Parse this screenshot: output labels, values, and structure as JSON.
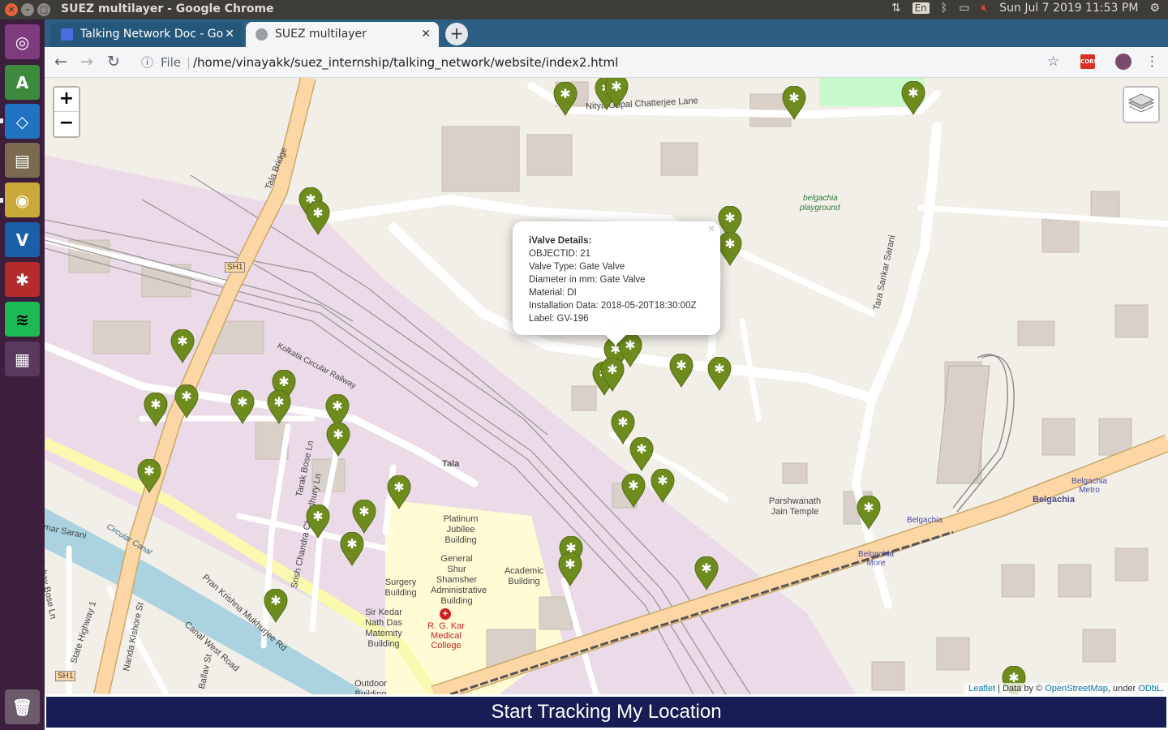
{
  "system": {
    "window_title": "SUEZ multilayer - Google Chrome",
    "lang": "En",
    "clock": "Sun Jul  7 2019 11:53 PM"
  },
  "tabs": [
    {
      "label": "Talking Network Doc - Go",
      "icon": "docs-icon"
    },
    {
      "label": "SUEZ multilayer",
      "icon": "globe-icon"
    }
  ],
  "address": {
    "scheme": "File",
    "url": "/home/vinayakk/suez_internship/talking_network/website/index2.html"
  },
  "map": {
    "zoom_in": "+",
    "zoom_out": "−",
    "popup": {
      "title": "iValve Details:",
      "objectid": "OBJECTID: 21",
      "valve_type": "Valve Type: Gate Valve",
      "diameter": "Diameter in mm: Gate Valve",
      "material": "Material: DI",
      "installation": "Installation Data: 2018-05-20T18:30:00Z",
      "label": "Label: GV-196"
    },
    "labels": {
      "nitya": "Nitya Gopal Chatterjee Lane",
      "playground1": "belgachia",
      "playground2": "playground",
      "tala_bridge": "Tala Bridge",
      "sh1": "SH1",
      "sh1b": "SH1",
      "tara_sankar": "Tara Sankar Sarani",
      "kolkata_rail": "Kolkata Circular Railway",
      "tala": "Tala",
      "tarak": "Tarak Bose Ln",
      "srish": "Srish Chandra Chowdhury Ln",
      "platinum": "Platinum Jubilee Building",
      "general": "General Shur Shamsher Administrative Building",
      "surgery": "Surgery Building",
      "academic": "Academic Building",
      "sir_kedar": "Sir Kedar Nath Das Maternity Building",
      "rgkar": "R. G. Kar Medical College",
      "outdoor": "Outdoor Building",
      "parshwanath": "Parshwanath Jain Temple",
      "belgachia": "Belgachia",
      "belgachia_station": "Belgachia",
      "belgachia_metro": "Belgachia Metro",
      "belgachia_more": "Belgachia More",
      "circular_canal": "Circular Canal",
      "prankrishna": "Pran Krishna Mukhurjee Rd",
      "canal_west": "Canal West Road",
      "state_highway": "State Highway 1",
      "nanda": "Nanda Kishore St",
      "akshay": "Akshay Bose Ln",
      "ballav": "Ballav St",
      "kumar": "mar Sarani"
    },
    "attribution": {
      "leaflet": "Leaflet",
      "sep": " | Data by © ",
      "osm": "OpenStreetMap",
      "under": ", under ",
      "odbl": "ODbL",
      "dot": "."
    },
    "marker_color": "#6e8c1e"
  },
  "bottom_button": "Start Tracking My Location"
}
